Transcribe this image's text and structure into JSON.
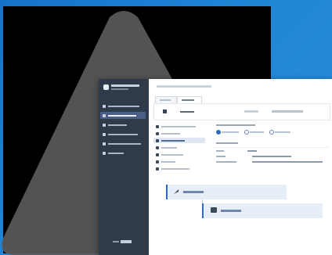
{
  "theme": {
    "background_blue": "#1f86d6",
    "sidebar_color": "#2f3a4a",
    "active_item_color": "#4a5f86",
    "accent_blue": "#2e6bbf"
  },
  "icons": [
    "app-logo-icon",
    "sidebar-item-icon",
    "header-icon",
    "flow-step-icon",
    "radio-icon"
  ],
  "note": ""
}
